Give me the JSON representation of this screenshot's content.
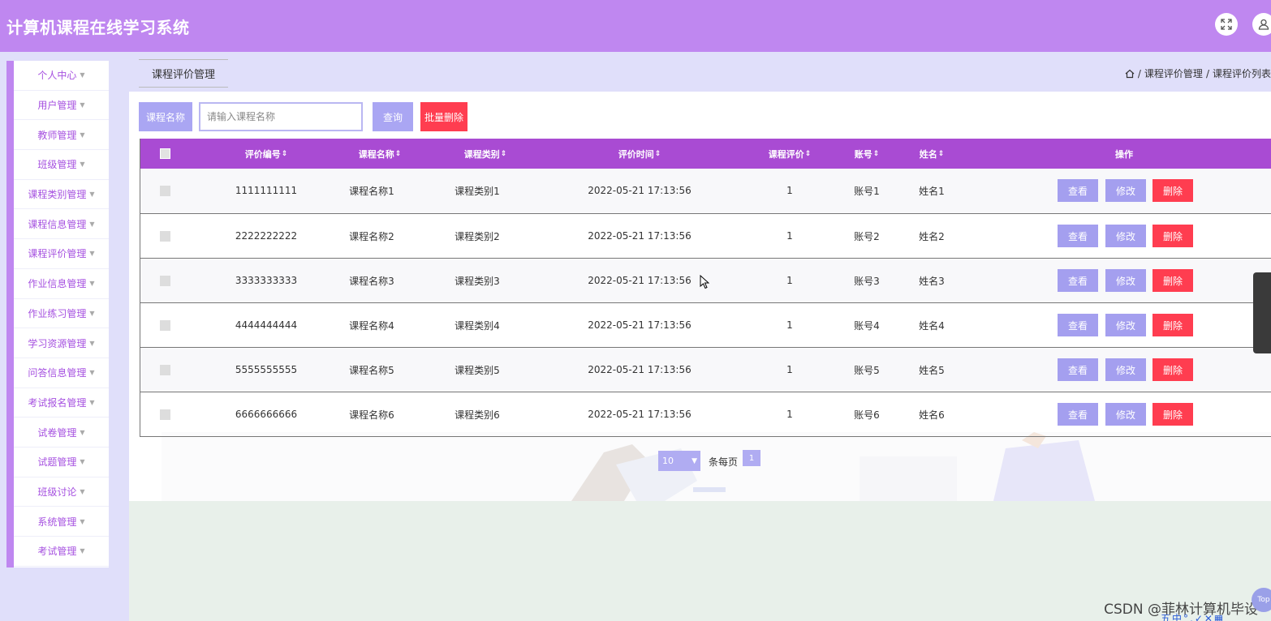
{
  "app": {
    "title": "计算机课程在线学习系统"
  },
  "header_icons": [
    "fullscreen-icon",
    "user-icon"
  ],
  "sidebar": {
    "items": [
      {
        "label": "个人中心"
      },
      {
        "label": "用户管理"
      },
      {
        "label": "教师管理"
      },
      {
        "label": "班级管理"
      },
      {
        "label": "课程类别管理"
      },
      {
        "label": "课程信息管理"
      },
      {
        "label": "课程评价管理"
      },
      {
        "label": "作业信息管理"
      },
      {
        "label": "作业练习管理"
      },
      {
        "label": "学习资源管理"
      },
      {
        "label": "问答信息管理"
      },
      {
        "label": "考试报名管理"
      },
      {
        "label": "试卷管理"
      },
      {
        "label": "试题管理"
      },
      {
        "label": "班级讨论"
      },
      {
        "label": "系统管理"
      },
      {
        "label": "考试管理"
      }
    ]
  },
  "tab": {
    "label": "课程评价管理"
  },
  "breadcrumb": {
    "sep": "/",
    "items": [
      "课程评价管理",
      "课程评价列表"
    ]
  },
  "search": {
    "label": "课程名称",
    "placeholder": "请输入课程名称",
    "query_label": "查询",
    "batch_delete_label": "批量删除"
  },
  "table": {
    "columns": [
      "评价编号",
      "课程名称",
      "课程类别",
      "评价时间",
      "课程评价",
      "账号",
      "姓名",
      "操作"
    ],
    "sort_glyph": "⇕",
    "actions": {
      "view": "查看",
      "edit": "修改",
      "delete": "删除"
    },
    "rows": [
      {
        "id": "1111111111",
        "course": "课程名称1",
        "category": "课程类别1",
        "time": "2022-05-21 17:13:56",
        "rating": "1",
        "account": "账号1",
        "name": "姓名1"
      },
      {
        "id": "2222222222",
        "course": "课程名称2",
        "category": "课程类别2",
        "time": "2022-05-21 17:13:56",
        "rating": "1",
        "account": "账号2",
        "name": "姓名2"
      },
      {
        "id": "3333333333",
        "course": "课程名称3",
        "category": "课程类别3",
        "time": "2022-05-21 17:13:56",
        "rating": "1",
        "account": "账号3",
        "name": "姓名3"
      },
      {
        "id": "4444444444",
        "course": "课程名称4",
        "category": "课程类别4",
        "time": "2022-05-21 17:13:56",
        "rating": "1",
        "account": "账号4",
        "name": "姓名4"
      },
      {
        "id": "5555555555",
        "course": "课程名称5",
        "category": "课程类别5",
        "time": "2022-05-21 17:13:56",
        "rating": "1",
        "account": "账号5",
        "name": "姓名5"
      },
      {
        "id": "6666666666",
        "course": "课程名称6",
        "category": "课程类别6",
        "time": "2022-05-21 17:13:56",
        "rating": "1",
        "account": "账号6",
        "name": "姓名6"
      }
    ]
  },
  "pagination": {
    "page_size": "10",
    "per_page_label": "条每页",
    "current_page": "1"
  },
  "watermark": "CSDN @菲林计算机毕设",
  "top_button": "Top",
  "ime_bar": "五中°,✓✕▦"
}
